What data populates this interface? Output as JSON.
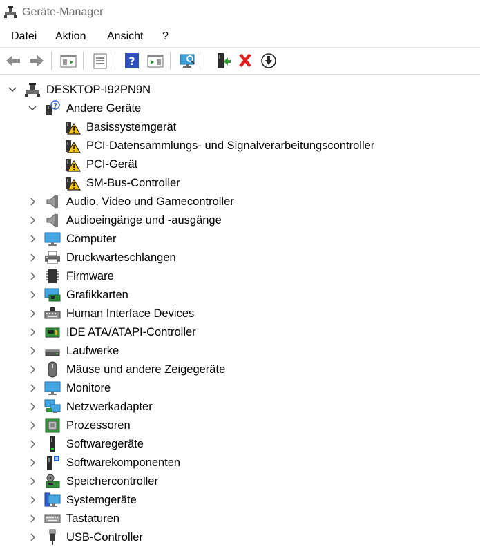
{
  "window": {
    "title": "Geräte-Manager",
    "icon": "device-manager-icon"
  },
  "menu": {
    "items": [
      "Datei",
      "Aktion",
      "Ansicht",
      "?"
    ]
  },
  "toolbar": {
    "buttons": [
      "back-arrow-icon",
      "forward-arrow-icon",
      "show-hide-console-tree-icon",
      "properties-icon",
      "help-icon",
      "action-pane-icon",
      "scan-hardware-changes-icon",
      "enable-driver-icon",
      "uninstall-device-icon",
      "update-driver-icon"
    ]
  },
  "tree": {
    "root": {
      "label": "DESKTOP-I92PN9N",
      "icon": "computer-network-icon"
    },
    "other_devices": {
      "label": "Andere Geräte",
      "icon": "unknown-device-icon",
      "children": [
        {
          "label": "Basissystemgerät",
          "icon": "warning-device-icon"
        },
        {
          "label": "PCI-Datensammlungs- und Signalverarbeitungscontroller",
          "icon": "warning-device-icon"
        },
        {
          "label": "PCI-Gerät",
          "icon": "warning-device-icon"
        },
        {
          "label": "SM-Bus-Controller",
          "icon": "warning-device-icon"
        }
      ]
    },
    "categories": [
      {
        "label": "Audio, Video und Gamecontroller",
        "icon": "speaker-icon"
      },
      {
        "label": "Audioeingänge und -ausgänge",
        "icon": "speaker-icon"
      },
      {
        "label": "Computer",
        "icon": "monitor-icon"
      },
      {
        "label": "Druckwarteschlangen",
        "icon": "printer-icon"
      },
      {
        "label": "Firmware",
        "icon": "firmware-chip-icon"
      },
      {
        "label": "Grafikkarten",
        "icon": "display-adapter-icon"
      },
      {
        "label": "Human Interface Devices",
        "icon": "hid-icon"
      },
      {
        "label": "IDE ATA/ATAPI-Controller",
        "icon": "ide-controller-icon"
      },
      {
        "label": "Laufwerke",
        "icon": "disk-drive-icon"
      },
      {
        "label": "Mäuse und andere Zeigegeräte",
        "icon": "mouse-icon"
      },
      {
        "label": "Monitore",
        "icon": "monitor-icon"
      },
      {
        "label": "Netzwerkadapter",
        "icon": "network-adapter-icon"
      },
      {
        "label": "Prozessoren",
        "icon": "processor-icon"
      },
      {
        "label": "Softwaregeräte",
        "icon": "software-device-icon"
      },
      {
        "label": "Softwarekomponenten",
        "icon": "software-component-icon"
      },
      {
        "label": "Speichercontroller",
        "icon": "storage-controller-icon"
      },
      {
        "label": "Systemgeräte",
        "icon": "system-device-icon"
      },
      {
        "label": "Tastaturen",
        "icon": "keyboard-icon"
      },
      {
        "label": "USB-Controller",
        "icon": "usb-icon"
      }
    ]
  }
}
